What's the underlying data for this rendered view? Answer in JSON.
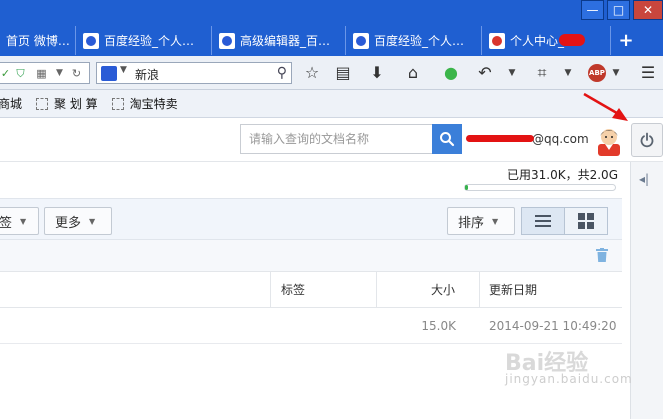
{
  "tabs": [
    {
      "label": "首页 微博…",
      "icon": "none"
    },
    {
      "label": "百度经验_个人…",
      "icon": "baidu-paw-icon"
    },
    {
      "label": "高级编辑器_百…",
      "icon": "baidu-paw-icon"
    },
    {
      "label": "百度经验_个人…",
      "icon": "baidu-paw-icon"
    },
    {
      "label": "个人中心_",
      "icon": "weibo-icon"
    }
  ],
  "new_tab_label": "+",
  "window_controls": {
    "minimize": "—",
    "maximize": "□",
    "close": "✕"
  },
  "searchbar": {
    "engine": "baidu",
    "value": "新浪"
  },
  "bookmarks": [
    "商城",
    "聚 划 算",
    "淘宝特卖"
  ],
  "doc_search": {
    "placeholder": "请输入查询的文档名称"
  },
  "user": {
    "email_suffix": "@qq.com"
  },
  "storage": {
    "text": "已用31.0K，共2.0G",
    "used_fraction": 0.02
  },
  "toolbar": {
    "tag_label": "签",
    "more_label": "更多",
    "sort_label": "排序"
  },
  "table": {
    "headers": {
      "tag": "标签",
      "size": "大小",
      "date": "更新日期"
    },
    "rows": [
      {
        "size": "15.0K",
        "date": "2014-09-21 10:49:20"
      }
    ]
  },
  "watermark": {
    "main": "Bai经验",
    "sub": "jingyan.baidu.com"
  },
  "colors": {
    "tabstrip": "#1f5fd1",
    "accent": "#3b7fd9",
    "annotation": "#e31313"
  }
}
